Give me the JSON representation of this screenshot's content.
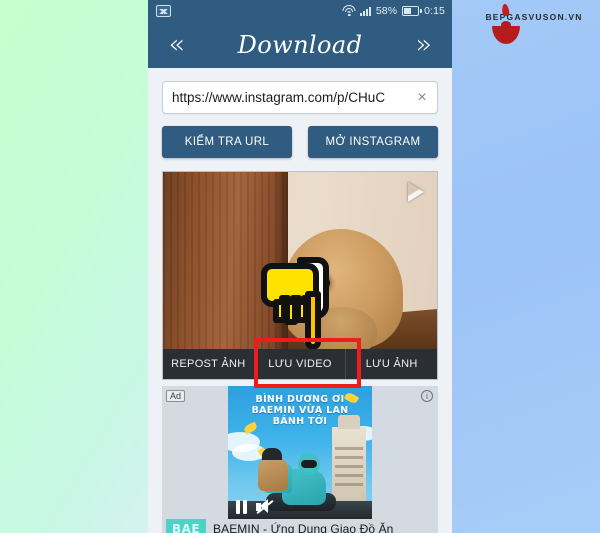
{
  "background": {
    "left_gradient": "#c7ffcf",
    "right_gradient": "#9cc3f7"
  },
  "watermark": {
    "text": "BEPGASVUSON.VN",
    "logo_color": "#b81b1b"
  },
  "statusbar": {
    "left_icon": "image-icon",
    "wifi_icon": "wifi-icon",
    "signal_icon": "signal-bars-icon",
    "battery_percent": "58%",
    "battery_icon": "battery-icon",
    "time": "0:15"
  },
  "appbar": {
    "back_label": "«",
    "title": "Download",
    "forward_label": "»",
    "color": "#2f5c80"
  },
  "url_field": {
    "value": "https://www.instagram.com/p/CHuC",
    "placeholder": "https://",
    "clear_label": "×"
  },
  "actions": {
    "check_url": "KIỂM TRA URL",
    "open_instagram": "MỞ INSTAGRAM"
  },
  "media": {
    "play_icon": "play-icon",
    "thumbnail_alt": "dog peeking behind wooden door",
    "cursor_icon": "pointing-hand-icon",
    "buttons": [
      {
        "label": "REPOST ẢNH",
        "name": "repost-photo-button",
        "highlighted": false
      },
      {
        "label": "LƯU VIDEO",
        "name": "save-video-button",
        "highlighted": true
      },
      {
        "label": "LƯU ẢNH",
        "name": "save-photo-button",
        "highlighted": false
      }
    ],
    "highlight_color": "#ee1c1c"
  },
  "ad": {
    "tag": "Ad",
    "info_label": "i",
    "headline_line1": "BÌNH DƯƠNG ƠI",
    "headline_line2": "BAEMIN VỪA LAN",
    "headline_line3": "BÁNH TỚI",
    "pause_icon": "pause-icon",
    "mute_icon": "mute-icon",
    "logo_text": "BAE",
    "title": "BAEMIN - Ứng Dụng Giao Đồ Ăn"
  }
}
